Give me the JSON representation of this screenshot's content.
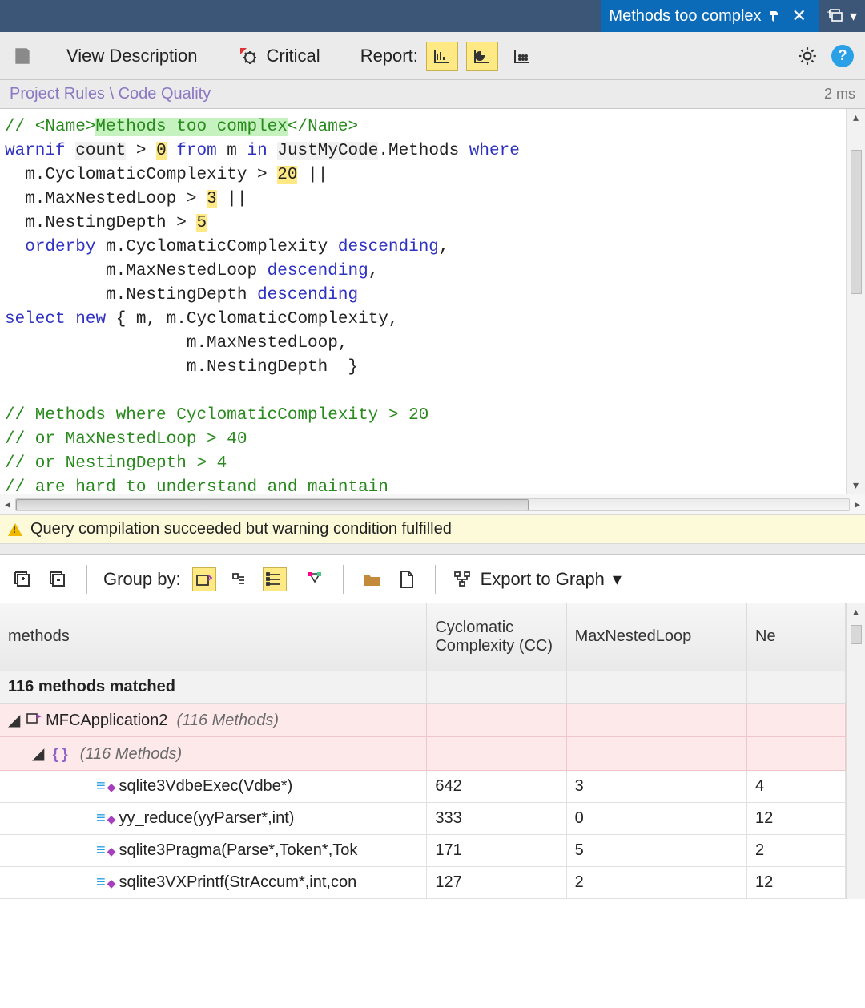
{
  "titlebar": {
    "tab_label": "Methods too complex"
  },
  "toolbar": {
    "view_description": "View Description",
    "critical": "Critical",
    "report_label": "Report:"
  },
  "breadcrumb": {
    "path": "Project Rules \\ Code Quality",
    "timing": "2 ms"
  },
  "code": {
    "l1a": "// <Name>",
    "l1b": "Methods too complex",
    "l1c": "</Name>",
    "l2a": "warnif",
    "l2b": "count",
    "l2c": " > ",
    "l2d": "0",
    "l2e": "from",
    "l2f": " m ",
    "l2g": "in",
    "l2h": "JustMyCode",
    "l2i": ".Methods ",
    "l2j": "where",
    "l3a": "  m.CyclomaticComplexity > ",
    "l3b": "20",
    "l3c": " ||",
    "l4a": "  m.MaxNestedLoop > ",
    "l4b": "3",
    "l4c": " ||",
    "l5a": "  m.NestingDepth > ",
    "l5b": "5",
    "l6a": "  ",
    "l6b": "orderby",
    "l6c": " m.CyclomaticComplexity ",
    "l6d": "descending",
    "l6e": ",",
    "l7a": "          m.MaxNestedLoop ",
    "l7b": "descending",
    "l7c": ",",
    "l8a": "          m.NestingDepth ",
    "l8b": "descending",
    "l9a": "select",
    "l9b": "new",
    "l9c": " { m, m.CyclomaticComplexity,",
    "l10": "                  m.MaxNestedLoop,",
    "l11": "                  m.NestingDepth  }",
    "l13": "// Methods where CyclomaticComplexity > 20",
    "l14": "// or MaxNestedLoop > 40",
    "l15": "// or NestingDepth > 4",
    "l16": "// are hard to understand and maintain"
  },
  "status": {
    "message": "Query compilation succeeded but warning condition fulfilled"
  },
  "results_toolbar": {
    "group_by": "Group by:",
    "export": "Export to Graph"
  },
  "columns": {
    "c1": "methods",
    "c2": "Cyclomatic Complexity (CC)",
    "c3": "MaxNestedLoop",
    "c4": "Ne"
  },
  "matched": {
    "text": "116 methods matched"
  },
  "groups": {
    "g1_name": "MFCApplication2",
    "g1_count": "(116 Methods)",
    "g2_count": "(116 Methods)"
  },
  "rows": [
    {
      "name": "sqlite3VdbeExec(Vdbe*)",
      "cc": "642",
      "ml": "3",
      "nd": "4"
    },
    {
      "name": "yy_reduce(yyParser*,int)",
      "cc": "333",
      "ml": "0",
      "nd": "12"
    },
    {
      "name": "sqlite3Pragma(Parse*,Token*,Tok",
      "cc": "171",
      "ml": "5",
      "nd": "2"
    },
    {
      "name": "sqlite3VXPrintf(StrAccum*,int,con",
      "cc": "127",
      "ml": "2",
      "nd": "12"
    }
  ]
}
